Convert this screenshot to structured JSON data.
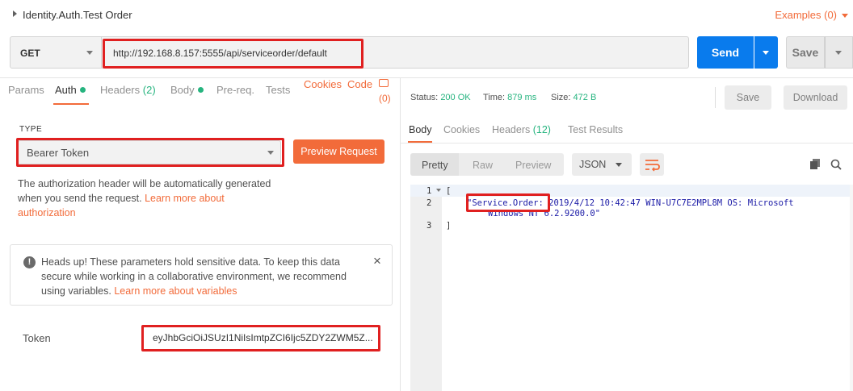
{
  "title": {
    "text": "Identity.Auth.Test Order",
    "examples": "Examples (0)"
  },
  "request": {
    "method": "GET",
    "url": "http://192.168.8.157:5555/api/serviceorder/default",
    "send_label": "Send",
    "save_label": "Save"
  },
  "left_tabs": {
    "params": "Params",
    "auth": "Auth",
    "headers": "Headers",
    "headers_count": "(2)",
    "body": "Body",
    "prereq": "Pre-req.",
    "tests": "Tests",
    "cookies": "Cookies",
    "code": "Code",
    "comments_count": "(0)"
  },
  "auth": {
    "type_label": "TYPE",
    "type_value": "Bearer Token",
    "preview_button": "Preview Request",
    "desc_prefix": "The authorization header will be automatically generated when you send the request. ",
    "desc_link": "Learn more about authorization",
    "alert_text": "Heads up! These parameters hold sensitive data. To keep this data secure while working in a collaborative environment, we recommend using variables. ",
    "alert_link": "Learn more about variables",
    "alert_icon": "!",
    "alert_close": "×",
    "token_label": "Token",
    "token_value": "eyJhbGciOiJSUzI1NiIsImtpZCI6Ijc5ZDY2ZWM5Z..."
  },
  "response": {
    "status_label": "Status:",
    "status_value": "200 OK",
    "time_label": "Time:",
    "time_value": "879 ms",
    "size_label": "Size:",
    "size_value": "472 B",
    "save_label": "Save",
    "download_label": "Download",
    "tabs": {
      "body": "Body",
      "cookies": "Cookies",
      "headers": "Headers",
      "headers_count": "(12)",
      "tests": "Test Results"
    },
    "format": {
      "pretty": "Pretty",
      "raw": "Raw",
      "preview": "Preview",
      "lang": "JSON"
    },
    "lines": {
      "n1": "1",
      "n2": "2",
      "n3": "3",
      "l1": "[",
      "l2_key": "\"Service.Order:",
      "l2_rest": " 2019/4/12 10:42:47 WIN-U7C7E2MPL8M OS: Microsoft",
      "l2_cont": "Windows NT 6.2.9200.0\"",
      "l3": "]"
    }
  },
  "colors": {
    "accent": "#f26b3a",
    "send": "#097bed",
    "success": "#26b47f",
    "highlight_box": "#e02020"
  }
}
